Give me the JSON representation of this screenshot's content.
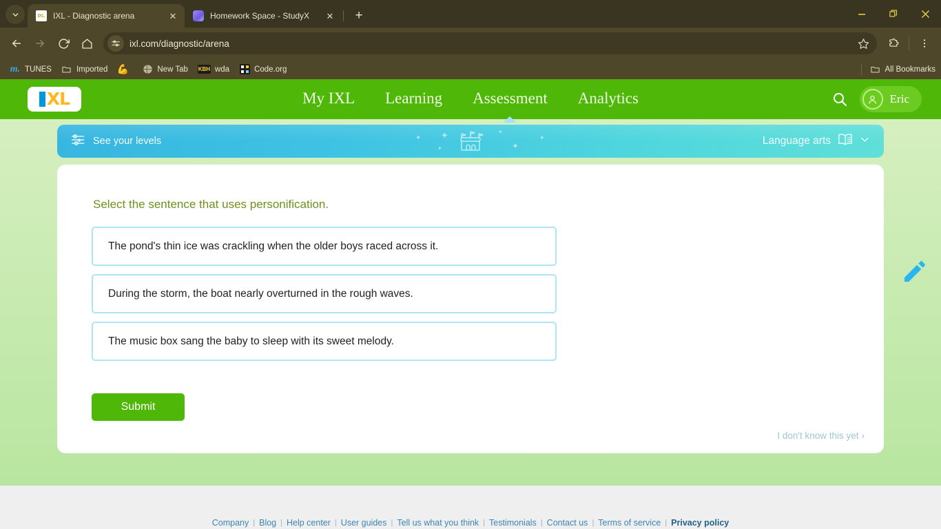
{
  "browser": {
    "tabs": [
      {
        "title": "IXL - Diagnostic arena",
        "favicon": "ixl-favicon",
        "active": true
      },
      {
        "title": "Homework Space - StudyX",
        "favicon": "studyx-favicon",
        "active": false
      }
    ],
    "new_tab_label": "+",
    "window_controls": {
      "minimize": "—",
      "maximize": "❐",
      "close": "✕"
    },
    "nav": {
      "back": "back-arrow",
      "forward": "forward-arrow",
      "reload": "reload-icon",
      "home": "home-icon"
    },
    "omnibox": {
      "url": "ixl.com/diagnostic/arena",
      "site_info_icon": "site-settings-icon",
      "star": "bookmark-star-icon"
    },
    "extensions_icon": "extensions-puzzle-icon",
    "menu_icon": "three-dot-menu-icon",
    "bookmarks": [
      {
        "label": "TUNES",
        "icon": "tunes-icon"
      },
      {
        "label": "Imported",
        "icon": "folder-icon"
      },
      {
        "label": "",
        "icon": "flexed-biceps-icon"
      },
      {
        "label": "New Tab",
        "icon": "globe-icon"
      },
      {
        "label": "wda",
        "icon": "kbh-icon"
      },
      {
        "label": "Code.org",
        "icon": "code-org-icon"
      }
    ],
    "all_bookmarks_label": "All Bookmarks"
  },
  "site": {
    "logo": {
      "i": "I",
      "xl": "XL"
    },
    "nav_items": [
      {
        "label": "My IXL",
        "active": false
      },
      {
        "label": "Learning",
        "active": false
      },
      {
        "label": "Assessment",
        "active": true
      },
      {
        "label": "Analytics",
        "active": false
      }
    ],
    "search_icon": "search-icon",
    "user": {
      "name": "Eric",
      "avatar_icon": "user-avatar-icon"
    },
    "colors": {
      "header_green": "#4fb708",
      "banner_blue": "#3fc3e3",
      "question_olive": "#6f8f1e",
      "choice_border": "#ade4f6"
    }
  },
  "levels_bar": {
    "label": "See your levels",
    "icon": "levels-sliders-icon",
    "center_icon": "arena-castle-icon",
    "subject": "Language arts",
    "subject_icon": "open-book-icon",
    "chevron": "chevron-down-icon"
  },
  "question": {
    "prompt": "Select the sentence that uses personification.",
    "choices": [
      "The pond's thin ice was crackling when the older boys raced across it.",
      "During the storm, the boat nearly overturned in the rough waves.",
      "The music box sang the baby to sleep with its sweet melody."
    ],
    "submit_label": "Submit",
    "skip_label": "I don't know this yet",
    "skip_chevron": "›",
    "scratchpad_icon": "pencil-icon"
  },
  "footer": {
    "links": [
      {
        "label": "Company",
        "bold": false
      },
      {
        "label": "Blog",
        "bold": false
      },
      {
        "label": "Help center",
        "bold": false
      },
      {
        "label": "User guides",
        "bold": false
      },
      {
        "label": "Tell us what you think",
        "bold": false
      },
      {
        "label": "Testimonials",
        "bold": false
      },
      {
        "label": "Contact us",
        "bold": false
      },
      {
        "label": "Terms of service",
        "bold": false
      },
      {
        "label": "Privacy policy",
        "bold": true
      }
    ],
    "separator": "|"
  }
}
